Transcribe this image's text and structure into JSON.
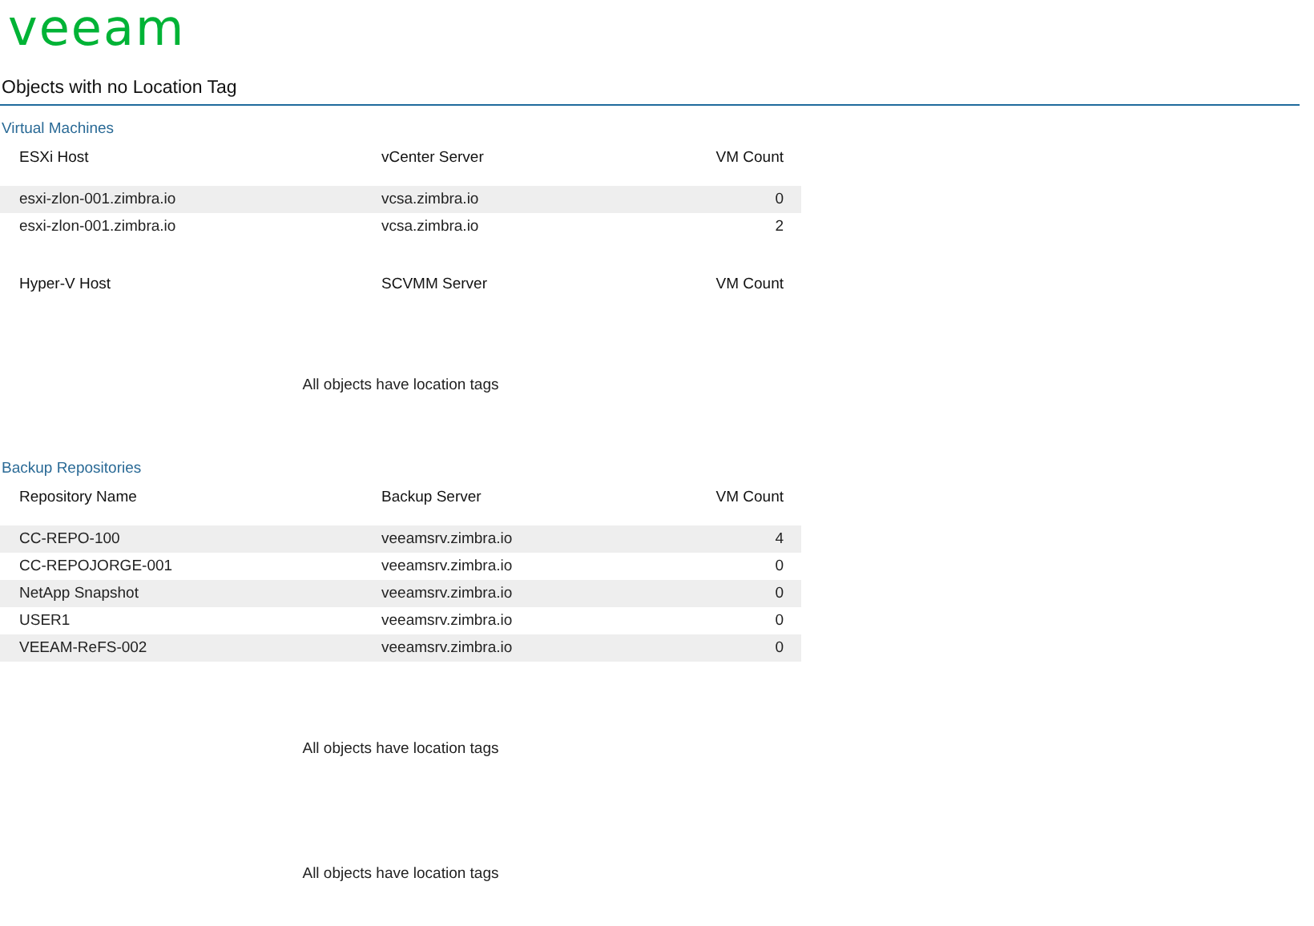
{
  "logo": "veeam",
  "title": "Objects with no Location Tag",
  "sections": [
    {
      "heading": "Virtual Machines",
      "blocks": [
        {
          "kind": "table",
          "columns": [
            "ESXi Host",
            "vCenter Server",
            "VM Count"
          ],
          "rows": [
            [
              "esxi-zlon-001.zimbra.io",
              "vcsa.zimbra.io",
              "0"
            ],
            [
              "esxi-zlon-001.zimbra.io",
              "vcsa.zimbra.io",
              "2"
            ]
          ]
        },
        {
          "kind": "table",
          "columns": [
            "Hyper-V Host",
            "SCVMM Server",
            "VM Count"
          ]
        },
        {
          "kind": "message",
          "text": "All objects have location tags"
        }
      ]
    },
    {
      "heading": "Backup Repositories",
      "blocks": [
        {
          "kind": "table",
          "columns": [
            "Repository Name",
            "Backup Server",
            "VM Count"
          ],
          "rows": [
            [
              "CC-REPO-100",
              "veeamsrv.zimbra.io",
              "4"
            ],
            [
              "CC-REPOJORGE-001",
              "veeamsrv.zimbra.io",
              "0"
            ],
            [
              "NetApp Snapshot",
              "veeamsrv.zimbra.io",
              "0"
            ],
            [
              "USER1",
              "veeamsrv.zimbra.io",
              "0"
            ],
            [
              "VEEAM-ReFS-002",
              "veeamsrv.zimbra.io",
              "0"
            ]
          ]
        },
        {
          "kind": "message",
          "text": "All objects have location tags"
        },
        {
          "kind": "message",
          "text": "All objects have location tags"
        }
      ]
    }
  ]
}
